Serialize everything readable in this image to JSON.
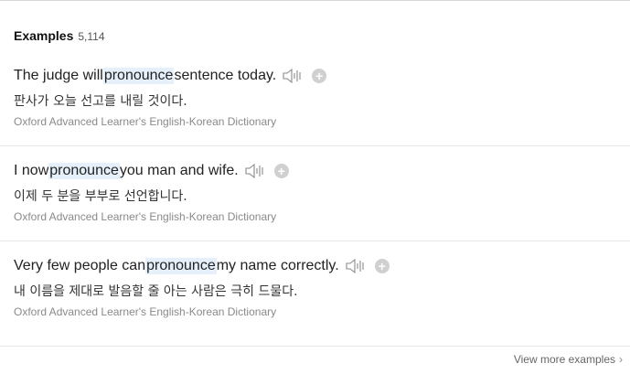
{
  "examples_section": {
    "title": "Examples",
    "count": "5,114",
    "items": [
      {
        "before": "The judge will ",
        "highlight": "pronounce",
        "after": " sentence today.",
        "translation": "판사가 오늘 선고를 내릴 것이다.",
        "source": "Oxford Advanced Learner's English-Korean Dictionary"
      },
      {
        "before": "I now ",
        "highlight": "pronounce",
        "after": " you man and wife.",
        "translation": "이제 두 분을 부부로 선언합니다.",
        "source": "Oxford Advanced Learner's English-Korean Dictionary"
      },
      {
        "before": "Very few people can ",
        "highlight": "pronounce",
        "after": " my name correctly.",
        "translation": "내 이름을 제대로 발음할 줄 아는 사람은 극히 드물다.",
        "source": "Oxford Advanced Learner's English-Korean Dictionary"
      }
    ],
    "view_more": "View more examples",
    "chevron": "›"
  },
  "colors": {
    "highlight_bg": "#e5f0fb",
    "source_text": "#8a8a8a",
    "plus_button": "#d0d0d0"
  },
  "icons": {
    "speaker": "speaker-icon",
    "add": "plus-icon",
    "more": "chevron-right-icon"
  }
}
